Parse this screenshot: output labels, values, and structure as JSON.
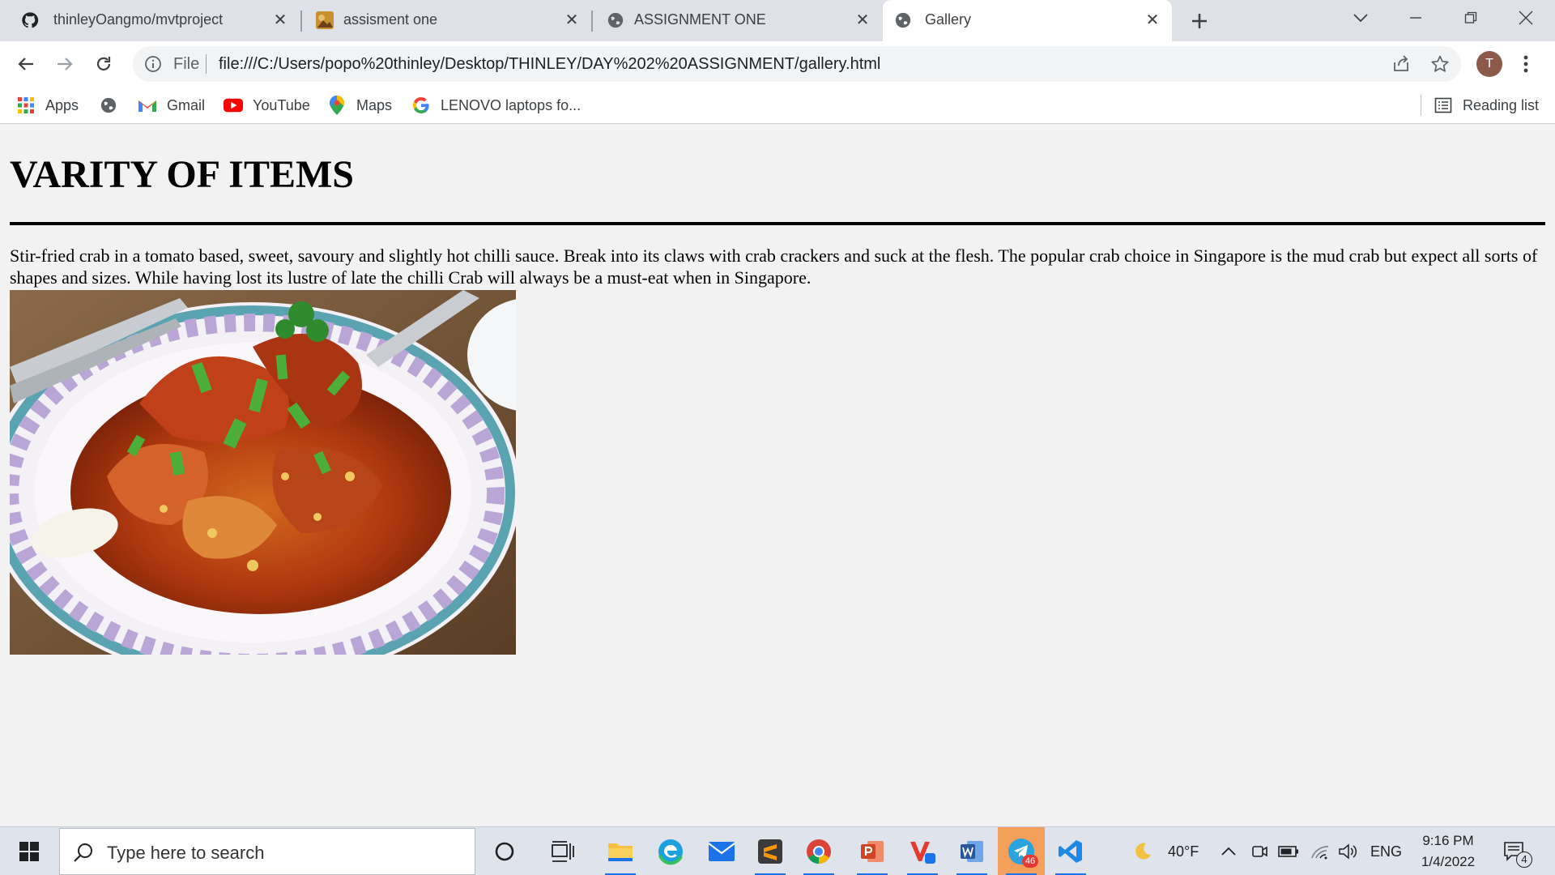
{
  "tabs": [
    {
      "title": "thinleyOangmo/mvtproject",
      "favicon": "github-icon",
      "active": false
    },
    {
      "title": "assisment one",
      "favicon": "image-favicon",
      "active": false
    },
    {
      "title": "ASSIGNMENT ONE",
      "favicon": "globe-icon",
      "active": false
    },
    {
      "title": "Gallery",
      "favicon": "globe-icon",
      "active": true
    }
  ],
  "toolbar": {
    "scheme_label": "File",
    "url": "file:///C:/Users/popo%20thinley/Desktop/THINLEY/DAY%202%20ASSIGNMENT/gallery.html",
    "avatar_letter": "T"
  },
  "bookmarks": {
    "items": [
      {
        "label": "Apps",
        "icon": "apps-grid-icon"
      },
      {
        "label": "",
        "icon": "globe-icon"
      },
      {
        "label": "Gmail",
        "icon": "gmail-icon"
      },
      {
        "label": "YouTube",
        "icon": "youtube-icon"
      },
      {
        "label": "Maps",
        "icon": "maps-icon"
      },
      {
        "label": "LENOVO laptops fo...",
        "icon": "google-icon"
      }
    ],
    "reading_list": "Reading list"
  },
  "page": {
    "heading": "VARITY OF ITEMS",
    "paragraph": "Stir-fried crab in a tomato based, sweet, savoury and slightly hot chilli sauce. Break into its claws with crab crackers and suck at the flesh. The popular crab choice in Singapore is the mud crab but expect all sorts of shapes and sizes. While having lost its lustre of late the chilli Crab will always be a must-eat when in Singapore."
  },
  "taskbar": {
    "search_placeholder": "Type here to search",
    "telegram_badge": "46",
    "weather": "40°F",
    "language": "ENG",
    "time": "9:16 PM",
    "date": "1/4/2022",
    "notification_count": "4"
  },
  "colors": {
    "tabstrip_bg": "#dee1e6",
    "page_bg": "#f2f2f2",
    "taskbar_bg": "#dfe3ec",
    "accent": "#1a73e8"
  }
}
